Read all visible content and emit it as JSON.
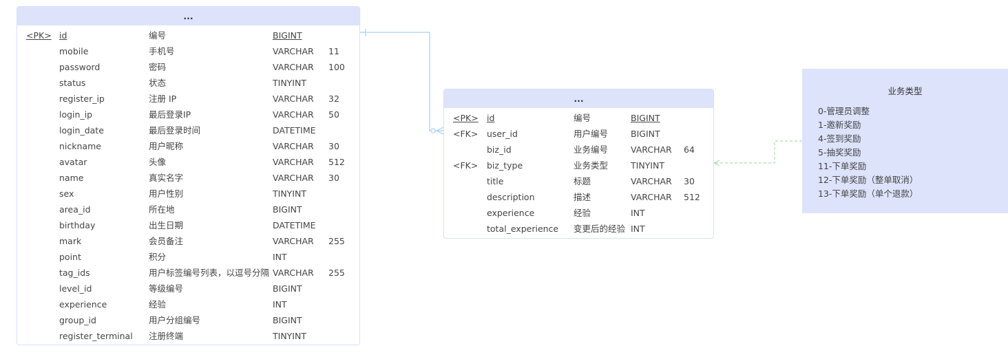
{
  "user_table": {
    "title": "...",
    "rows": [
      {
        "key": "<PK>",
        "name": "id",
        "comment": "编号",
        "type": "BIGINT",
        "length": "",
        "underline": true
      },
      {
        "key": "",
        "name": "mobile",
        "comment": "手机号",
        "type": "VARCHAR",
        "length": "11"
      },
      {
        "key": "",
        "name": "password",
        "comment": "密码",
        "type": "VARCHAR",
        "length": "100"
      },
      {
        "key": "",
        "name": "status",
        "comment": "状态",
        "type": "TINYINT",
        "length": ""
      },
      {
        "key": "",
        "name": "register_ip",
        "comment": "注册 IP",
        "type": "VARCHAR",
        "length": "32"
      },
      {
        "key": "",
        "name": "login_ip",
        "comment": "最后登录IP",
        "type": "VARCHAR",
        "length": "50"
      },
      {
        "key": "",
        "name": "login_date",
        "comment": "最后登录时间",
        "type": "DATETIME",
        "length": ""
      },
      {
        "key": "",
        "name": "nickname",
        "comment": "用户昵称",
        "type": "VARCHAR",
        "length": "30"
      },
      {
        "key": "",
        "name": "avatar",
        "comment": "头像",
        "type": "VARCHAR",
        "length": "512"
      },
      {
        "key": "",
        "name": "name",
        "comment": "真实名字",
        "type": "VARCHAR",
        "length": "30"
      },
      {
        "key": "",
        "name": "sex",
        "comment": "用户性别",
        "type": "TINYINT",
        "length": ""
      },
      {
        "key": "",
        "name": "area_id",
        "comment": "所在地",
        "type": "BIGINT",
        "length": ""
      },
      {
        "key": "",
        "name": "birthday",
        "comment": "出生日期",
        "type": "DATETIME",
        "length": ""
      },
      {
        "key": "",
        "name": "mark",
        "comment": "会员备注",
        "type": "VARCHAR",
        "length": "255"
      },
      {
        "key": "",
        "name": "point",
        "comment": "积分",
        "type": "INT",
        "length": ""
      },
      {
        "key": "",
        "name": "tag_ids",
        "comment": "用户标签编号列表，以逗号分隔",
        "type": "VARCHAR",
        "length": "255"
      },
      {
        "key": "",
        "name": "level_id",
        "comment": "等级编号",
        "type": "BIGINT",
        "length": ""
      },
      {
        "key": "",
        "name": "experience",
        "comment": "经验",
        "type": "INT",
        "length": ""
      },
      {
        "key": "",
        "name": "group_id",
        "comment": "用户分组编号",
        "type": "BIGINT",
        "length": ""
      },
      {
        "key": "",
        "name": "register_terminal",
        "comment": "注册终端",
        "type": "TINYINT",
        "length": ""
      }
    ]
  },
  "record_table": {
    "title": "...",
    "rows": [
      {
        "key": "<PK>",
        "name": "id",
        "comment": "编号",
        "type": "BIGINT",
        "length": "",
        "underline": true
      },
      {
        "key": "<FK>",
        "name": "user_id",
        "comment": "用户编号",
        "type": "BIGINT",
        "length": ""
      },
      {
        "key": "",
        "name": "biz_id",
        "comment": "业务编号",
        "type": "VARCHAR",
        "length": "64"
      },
      {
        "key": "<FK>",
        "name": "biz_type",
        "comment": "业务类型",
        "type": "TINYINT",
        "length": ""
      },
      {
        "key": "",
        "name": "title",
        "comment": "标题",
        "type": "VARCHAR",
        "length": "30"
      },
      {
        "key": "",
        "name": "description",
        "comment": "描述",
        "type": "VARCHAR",
        "length": "512"
      },
      {
        "key": "",
        "name": "experience",
        "comment": "经验",
        "type": "INT",
        "length": ""
      },
      {
        "key": "",
        "name": "total_experience",
        "comment": "变更后的经验",
        "type": "INT",
        "length": ""
      }
    ]
  },
  "note": {
    "title": "业务类型",
    "lines": [
      "0-管理员调整",
      "1-邀新奖励",
      "4-签到奖励",
      "5-抽奖奖励",
      "11-下单奖励",
      "12-下单奖励（整单取消）",
      "13-下单奖励（单个退款）"
    ]
  },
  "colors": {
    "header_bg": "#dde3fb",
    "note_bg": "#dde3fb",
    "border": "#d7defb",
    "relation_line": "#a9cdf3",
    "note_link_line": "#a6e3a6",
    "text": "#444444"
  }
}
